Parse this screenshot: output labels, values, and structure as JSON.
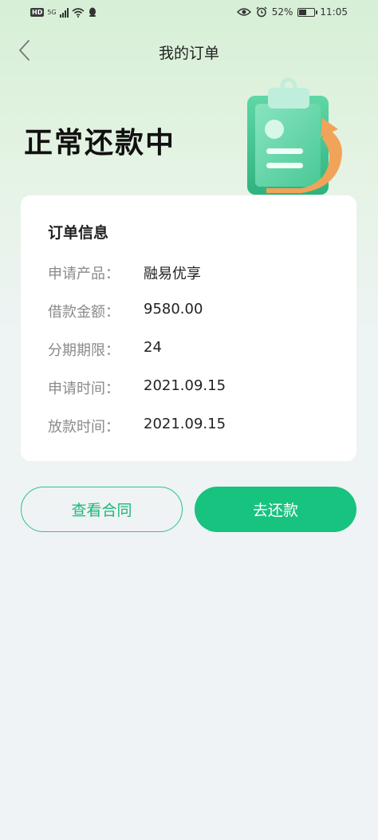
{
  "status_bar": {
    "hd": "HD",
    "signal": "5G",
    "battery": "52%",
    "battery_level": 0.52,
    "time": "11:05"
  },
  "nav": {
    "title": "我的订单"
  },
  "hero": {
    "status_title": "正常还款中"
  },
  "order": {
    "section_title": "订单信息",
    "rows": [
      {
        "label": "申请产品：",
        "value": "融易优享"
      },
      {
        "label": "借款金额：",
        "value": "9580.00"
      },
      {
        "label": "分期期限：",
        "value": "24"
      },
      {
        "label": "申请时间：",
        "value": "2021.09.15"
      },
      {
        "label": "放款时间：",
        "value": "2021.09.15"
      }
    ]
  },
  "actions": {
    "view_contract": "查看合同",
    "repay": "去还款"
  },
  "colors": {
    "accent": "#18c27f",
    "accent_outline": "#2fc286",
    "illustration_orange": "#f2a35a"
  }
}
